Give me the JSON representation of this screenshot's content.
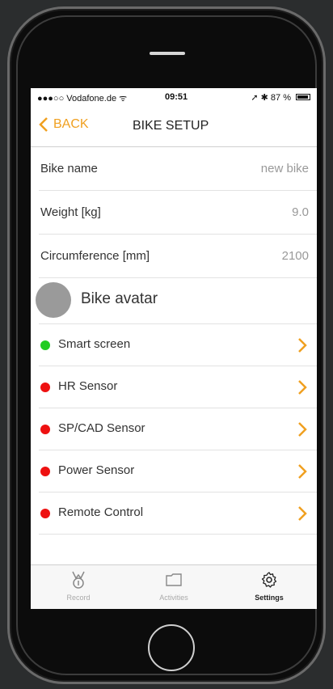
{
  "statusbar": {
    "carrier": "●●●○○ Vodafone.de ᯤ",
    "time": "09:51",
    "right": "➚ ✱ 87 %"
  },
  "navbar": {
    "back_label": "BACK",
    "title": "BIKE SETUP"
  },
  "fields": [
    {
      "label": "Bike name",
      "value": "new bike"
    },
    {
      "label": "Weight [kg]",
      "value": "9.0"
    },
    {
      "label": "Circumference [mm]",
      "value": "2100"
    }
  ],
  "avatar": {
    "label": "Bike avatar"
  },
  "sensors": [
    {
      "label": "Smart screen",
      "status": "connected",
      "color": "#22cc22"
    },
    {
      "label": "HR Sensor",
      "status": "disconnected",
      "color": "#ee1111"
    },
    {
      "label": "SP/CAD Sensor",
      "status": "disconnected",
      "color": "#ee1111"
    },
    {
      "label": "Power Sensor",
      "status": "disconnected",
      "color": "#ee1111"
    },
    {
      "label": "Remote Control",
      "status": "disconnected",
      "color": "#ee1111"
    }
  ],
  "tabs": [
    {
      "label": "Record",
      "icon": "medal-icon",
      "active": false
    },
    {
      "label": "Activities",
      "icon": "folder-icon",
      "active": false
    },
    {
      "label": "Settings",
      "icon": "gear-icon",
      "active": true
    }
  ],
  "colors": {
    "accent": "#f0a020",
    "inactive_tab": "#aaaaaa",
    "active_tab": "#222222"
  }
}
